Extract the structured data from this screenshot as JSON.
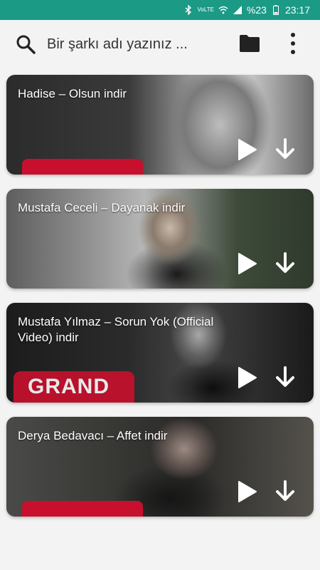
{
  "status_bar": {
    "volte_label": "VoLTE",
    "battery_percent": "%23",
    "time": "23:17",
    "bg_color": "#1b9a86"
  },
  "toolbar": {
    "search_placeholder": "Bir şarkı adı yazınız ...",
    "search_icon": "search-icon",
    "folder_icon": "folder-icon",
    "more_icon": "more-vert-icon"
  },
  "songs": [
    {
      "title": "Hadise – Olsun indir"
    },
    {
      "title": "Mustafa Ceceli – Dayanak indir"
    },
    {
      "title": "Mustafa Yılmaz – Sorun Yok (Official Video) indir"
    },
    {
      "title": "Derya Bedavacı – Affet indir"
    }
  ],
  "badges": {
    "grand": "GRAND"
  }
}
